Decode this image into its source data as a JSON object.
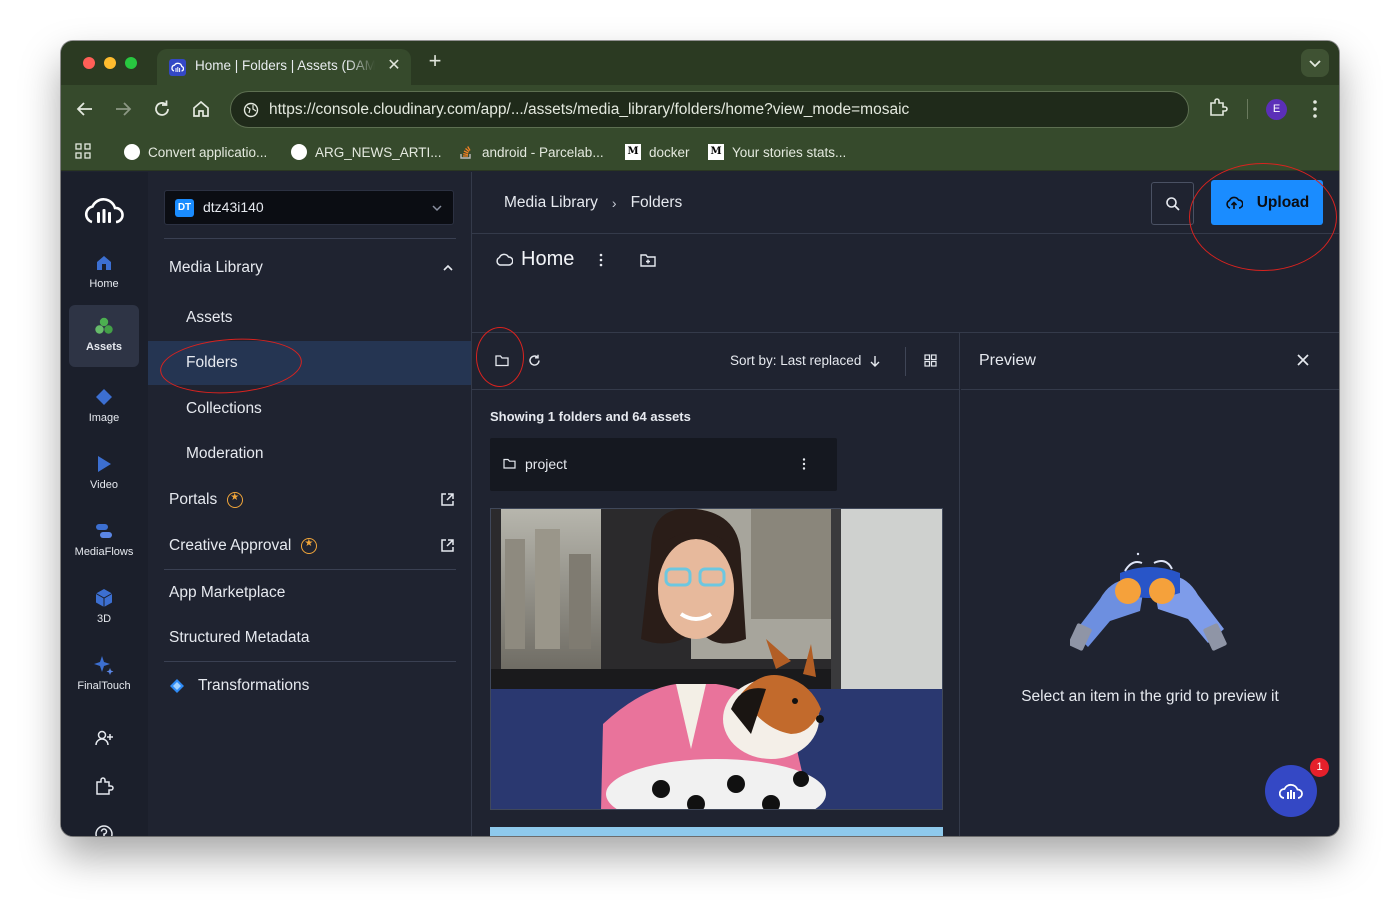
{
  "browser": {
    "tab_title": "Home | Folders | Assets (DAM)",
    "url": "https://console.cloudinary.com/app/.../assets/media_library/folders/home?view_mode=mosaic",
    "profile_initial": "E",
    "bookmarks": [
      {
        "label": "Convert applicatio...",
        "icon": "github-icon"
      },
      {
        "label": "ARG_NEWS_ARTI...",
        "icon": "github-icon"
      },
      {
        "label": "android - Parcelab...",
        "icon": "stackoverflow-icon"
      },
      {
        "label": "docker",
        "icon": "medium-icon"
      },
      {
        "label": "Your stories stats...",
        "icon": "medium-icon"
      }
    ]
  },
  "rail": {
    "items": [
      {
        "label": "Home",
        "icon": "home-icon"
      },
      {
        "label": "Assets",
        "icon": "assets-icon",
        "active": true
      },
      {
        "label": "Image",
        "icon": "image-icon"
      },
      {
        "label": "Video",
        "icon": "video-icon"
      },
      {
        "label": "MediaFlows",
        "icon": "mediaflows-icon"
      },
      {
        "label": "3D",
        "icon": "3d-icon"
      },
      {
        "label": "FinalTouch",
        "icon": "finaltouch-icon"
      }
    ]
  },
  "subnav": {
    "cloud_badge": "DT",
    "cloud_name": "dtz43i140",
    "section": "Media Library",
    "items": [
      "Assets",
      "Folders",
      "Collections",
      "Moderation"
    ],
    "portals": "Portals",
    "creative_approval": "Creative Approval",
    "app_marketplace": "App Marketplace",
    "structured_metadata": "Structured Metadata",
    "transformations": "Transformations"
  },
  "main": {
    "breadcrumb": [
      "Media Library",
      "Folders"
    ],
    "upload_label": "Upload",
    "folder_title": "Home",
    "sort_label": "Sort by: Last replaced",
    "count_text": "Showing 1 folders and 64 assets",
    "folder_card_name": "project"
  },
  "preview": {
    "title": "Preview",
    "message": "Select an item in the grid to preview it",
    "chat_badge": "1"
  },
  "colors": {
    "accent": "#1a8cff",
    "selected_bg": "#253552",
    "annotation": "#d8231f"
  }
}
